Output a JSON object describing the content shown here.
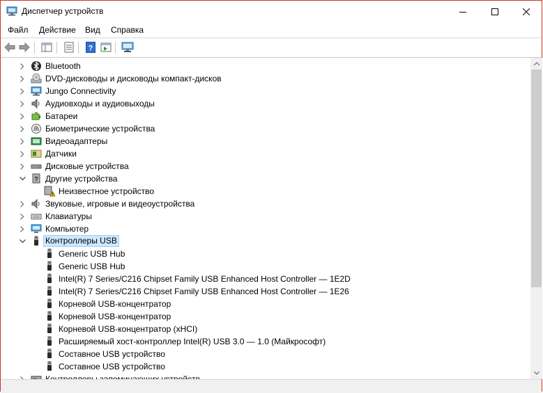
{
  "window": {
    "title": "Диспетчер устройств"
  },
  "menu": [
    "Файл",
    "Действие",
    "Вид",
    "Справка"
  ],
  "toolbar": [
    "back",
    "forward",
    "properties",
    "show-hide",
    "help",
    "run",
    "monitor"
  ],
  "tree": [
    {
      "label": "Bluetooth",
      "level": 0,
      "state": "collapsed",
      "icon": "bluetooth-icon"
    },
    {
      "label": "DVD-дисководы и дисководы компакт-дисков",
      "level": 0,
      "state": "collapsed",
      "icon": "dvd-drive-icon"
    },
    {
      "label": "Jungo Connectivity",
      "level": 0,
      "state": "collapsed",
      "icon": "monitor-icon"
    },
    {
      "label": "Аудиовходы и аудиовыходы",
      "level": 0,
      "state": "collapsed",
      "icon": "speaker-icon"
    },
    {
      "label": "Батареи",
      "level": 0,
      "state": "collapsed",
      "icon": "battery-icon"
    },
    {
      "label": "Биометрические устройства",
      "level": 0,
      "state": "collapsed",
      "icon": "fingerprint-icon"
    },
    {
      "label": "Видеоадаптеры",
      "level": 0,
      "state": "collapsed",
      "icon": "display-adapter-icon"
    },
    {
      "label": "Датчики",
      "level": 0,
      "state": "collapsed",
      "icon": "sensor-icon"
    },
    {
      "label": "Дисковые устройства",
      "level": 0,
      "state": "collapsed",
      "icon": "disk-drive-icon"
    },
    {
      "label": "Другие устройства",
      "level": 0,
      "state": "expanded",
      "icon": "other-devices-icon"
    },
    {
      "label": "Неизвестное устройство",
      "level": 1,
      "state": "leaf",
      "icon": "unknown-device-warning-icon"
    },
    {
      "label": "Звуковые, игровые и видеоустройства",
      "level": 0,
      "state": "collapsed",
      "icon": "speaker-icon"
    },
    {
      "label": "Клавиатуры",
      "level": 0,
      "state": "collapsed",
      "icon": "keyboard-icon"
    },
    {
      "label": "Компьютер",
      "level": 0,
      "state": "collapsed",
      "icon": "computer-icon"
    },
    {
      "label": "Контроллеры USB",
      "level": 0,
      "state": "expanded",
      "icon": "usb-icon",
      "selected": true
    },
    {
      "label": "Generic USB Hub",
      "level": 1,
      "state": "leaf",
      "icon": "usb-icon"
    },
    {
      "label": "Generic USB Hub",
      "level": 1,
      "state": "leaf",
      "icon": "usb-icon"
    },
    {
      "label": "Intel(R) 7 Series/C216 Chipset Family USB Enhanced Host Controller — 1E2D",
      "level": 1,
      "state": "leaf",
      "icon": "usb-icon"
    },
    {
      "label": "Intel(R) 7 Series/C216 Chipset Family USB Enhanced Host Controller — 1E26",
      "level": 1,
      "state": "leaf",
      "icon": "usb-icon"
    },
    {
      "label": "Корневой USB-концентратор",
      "level": 1,
      "state": "leaf",
      "icon": "usb-icon"
    },
    {
      "label": "Корневой USB-концентратор",
      "level": 1,
      "state": "leaf",
      "icon": "usb-icon"
    },
    {
      "label": "Корневой USB-концентратор (xHCI)",
      "level": 1,
      "state": "leaf",
      "icon": "usb-icon"
    },
    {
      "label": "Расширяемый хост-контроллер Intel(R) USB 3.0 — 1.0 (Майкрософт)",
      "level": 1,
      "state": "leaf",
      "icon": "usb-icon"
    },
    {
      "label": "Составное USB устройство",
      "level": 1,
      "state": "leaf",
      "icon": "usb-icon"
    },
    {
      "label": "Составное USB устройство",
      "level": 1,
      "state": "leaf",
      "icon": "usb-icon"
    },
    {
      "label": "Контроллеры запоминающих устройств",
      "level": 0,
      "state": "collapsed",
      "icon": "storage-controller-icon"
    }
  ]
}
